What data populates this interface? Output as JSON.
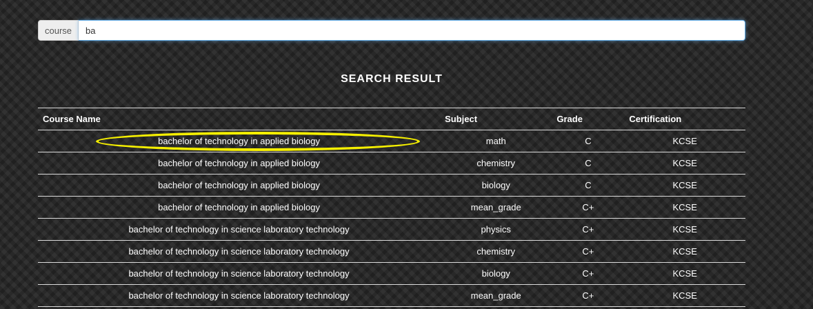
{
  "search": {
    "label": "course",
    "value": "ba"
  },
  "result_title": "SEARCH RESULT",
  "table": {
    "headers": {
      "course": "Course Name",
      "subject": "Subject",
      "grade": "Grade",
      "certification": "Certification"
    },
    "rows": [
      {
        "course": "bachelor of technology in applied biology",
        "subject": "math",
        "grade": "C",
        "certification": "KCSE"
      },
      {
        "course": "bachelor of technology in applied biology",
        "subject": "chemistry",
        "grade": "C",
        "certification": "KCSE"
      },
      {
        "course": "bachelor of technology in applied biology",
        "subject": "biology",
        "grade": "C",
        "certification": "KCSE"
      },
      {
        "course": "bachelor of technology in applied biology",
        "subject": "mean_grade",
        "grade": "C+",
        "certification": "KCSE"
      },
      {
        "course": "bachelor of technology in science laboratory technology",
        "subject": "physics",
        "grade": "C+",
        "certification": "KCSE"
      },
      {
        "course": "bachelor of technology in science laboratory technology",
        "subject": "chemistry",
        "grade": "C+",
        "certification": "KCSE"
      },
      {
        "course": "bachelor of technology in science laboratory technology",
        "subject": "biology",
        "grade": "C+",
        "certification": "KCSE"
      },
      {
        "course": "bachelor of technology in science laboratory technology",
        "subject": "mean_grade",
        "grade": "C+",
        "certification": "KCSE"
      }
    ]
  },
  "colors": {
    "highlight": "#f5ef00",
    "input_focus": "#66afe9"
  }
}
